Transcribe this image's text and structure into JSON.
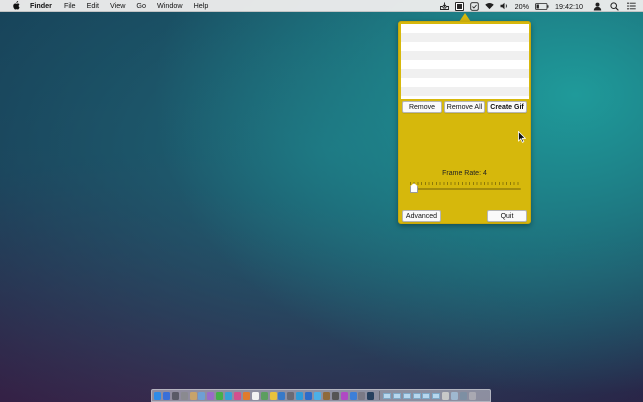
{
  "menubar": {
    "apple_icon": "apple-icon",
    "app_name": "Finder",
    "items": [
      "File",
      "Edit",
      "View",
      "Go",
      "Window",
      "Help"
    ],
    "battery_percent": "20%",
    "clock": "19:42:10"
  },
  "popover": {
    "list_rows": 8,
    "buttons": {
      "remove": "Remove",
      "remove_all": "Remove All",
      "create_gif": "Create Gif",
      "advanced": "Advanced",
      "quit": "Quit"
    },
    "frame_rate": {
      "label": "Frame Rate: 4",
      "value": 4
    }
  },
  "colors": {
    "popover_bg": "#d6b80c",
    "menubar_bg": "#ececec"
  }
}
